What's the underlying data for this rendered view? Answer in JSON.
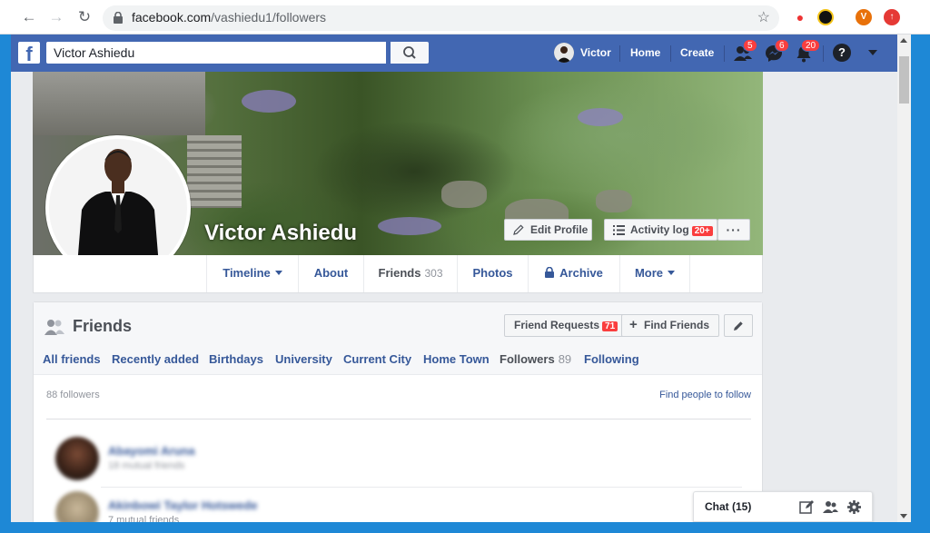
{
  "browser": {
    "url_host": "facebook.com",
    "url_path": "/vashiedu1/followers",
    "ext_avatar_letter": "V"
  },
  "header": {
    "logo": "f",
    "search_value": "Victor Ashiedu",
    "user_name": "Victor",
    "home": "Home",
    "create": "Create",
    "friend_requests_badge": "5",
    "messages_badge": "6",
    "notifications_badge": "20",
    "help": "?"
  },
  "profile": {
    "name": "Victor Ashiedu",
    "edit_profile": "Edit Profile",
    "activity_log": "Activity log",
    "activity_badge": "20+",
    "more_dots": "···"
  },
  "tabs": [
    {
      "label": "Timeline"
    },
    {
      "label": "About"
    },
    {
      "label": "Friends",
      "count": "303"
    },
    {
      "label": "Photos"
    },
    {
      "label": "Archive"
    },
    {
      "label": "More"
    }
  ],
  "friends_card": {
    "title": "Friends",
    "friend_requests": "Friend Requests",
    "friend_requests_badge": "71",
    "find_friends": "Find Friends",
    "subtabs": [
      {
        "label": "All friends"
      },
      {
        "label": "Recently added"
      },
      {
        "label": "Birthdays"
      },
      {
        "label": "University"
      },
      {
        "label": "Current City"
      },
      {
        "label": "Home Town"
      },
      {
        "label": "Followers",
        "count": "89"
      },
      {
        "label": "Following"
      }
    ],
    "followers_count": "88 followers",
    "find_people": "Find people to follow",
    "rows": [
      {
        "name": "Abayomi Aruna",
        "sub": "18 mutual friends"
      },
      {
        "name": "Akinbowi Taylor Hotswede",
        "sub": "7 mutual friends"
      }
    ]
  },
  "chat": {
    "label": "Chat (15)"
  }
}
